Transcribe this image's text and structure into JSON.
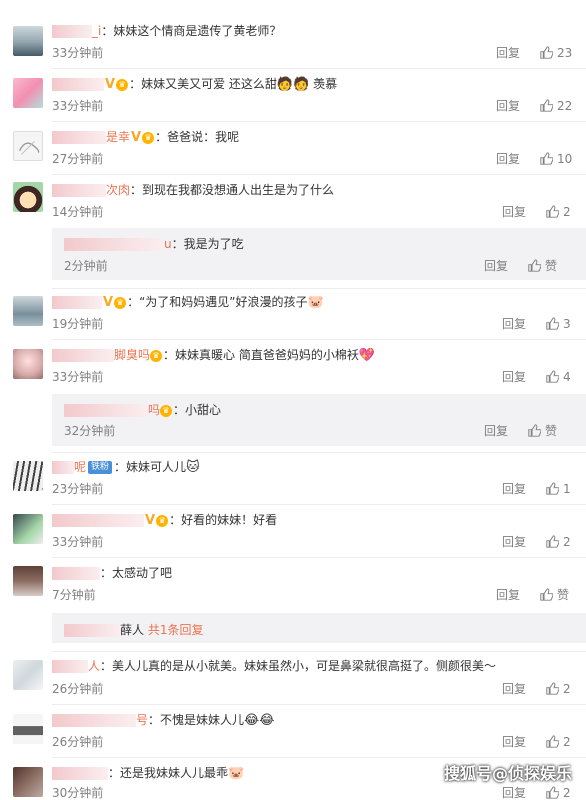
{
  "comments": [
    {
      "user_tail": "_i",
      "text": "妹妹这个情商是遗传了黄老师？",
      "time": "33分钟前",
      "reply": "回复",
      "likes": "23"
    },
    {
      "user_tail": "",
      "text": "妹妹又美又可爱 还这么甜",
      "text2": "羡慕",
      "time": "33分钟前",
      "reply": "回复",
      "likes": "22"
    },
    {
      "user_tail": "是幸",
      "text": "爸爸说：我呢",
      "time": "27分钟前",
      "reply": "回复",
      "likes": "10"
    },
    {
      "user_tail": "次肉",
      "text": "到现在我都没想通人出生是为了什么",
      "time": "14分钟前",
      "reply": "回复",
      "likes": "2",
      "sub": {
        "user_tail": "u",
        "text": "我是为了吃",
        "time": "2分钟前",
        "reply": "回复",
        "likes": "赞"
      }
    },
    {
      "user_tail": "",
      "text": "“为了和妈妈遇见”好浪漫的孩子",
      "time": "19分钟前",
      "reply": "回复",
      "likes": "3"
    },
    {
      "user_tail": "脚臭吗",
      "text": "妹妹真暖心 简直爸爸妈妈的小棉袄",
      "time": "33分钟前",
      "reply": "回复",
      "likes": "4",
      "sub": {
        "user_tail": "吗",
        "text": "小甜心",
        "time": "32分钟前",
        "reply": "回复",
        "likes": "赞"
      }
    },
    {
      "user_tail": "呢",
      "fan_badge": "铁粉",
      "text": "妹妹可人儿",
      "time": "23分钟前",
      "reply": "回复",
      "likes": "1"
    },
    {
      "user_tail": "",
      "text": "好看的妹妹！好看",
      "time": "33分钟前",
      "reply": "回复",
      "likes": "2"
    },
    {
      "user_tail": "",
      "text": "太感动了吧",
      "time": "7分钟前",
      "reply": "回复",
      "likes": "赞",
      "more": {
        "user_tail": "薛人",
        "label": "共1条回复"
      }
    },
    {
      "user_tail": "人",
      "text": "美人儿真的是从小就美。妹妹虽然小，可是鼻梁就很高挺了。侧颜很美～",
      "time": "26分钟前",
      "reply": "回复",
      "likes": "2"
    },
    {
      "user_tail": "号",
      "text": "不愧是妹妹人儿",
      "time": "26分钟前",
      "reply": "回复",
      "likes": "2"
    },
    {
      "user_tail": "",
      "text": "还是我妹妹人儿最乖",
      "time": "30分钟前",
      "reply": "回复",
      "likes": "2"
    }
  ],
  "watermark": "搜狐号@侦探娱乐",
  "colors": {
    "accent": "#eb7350",
    "meta": "#808080",
    "subbox": "#f2f2f5"
  }
}
